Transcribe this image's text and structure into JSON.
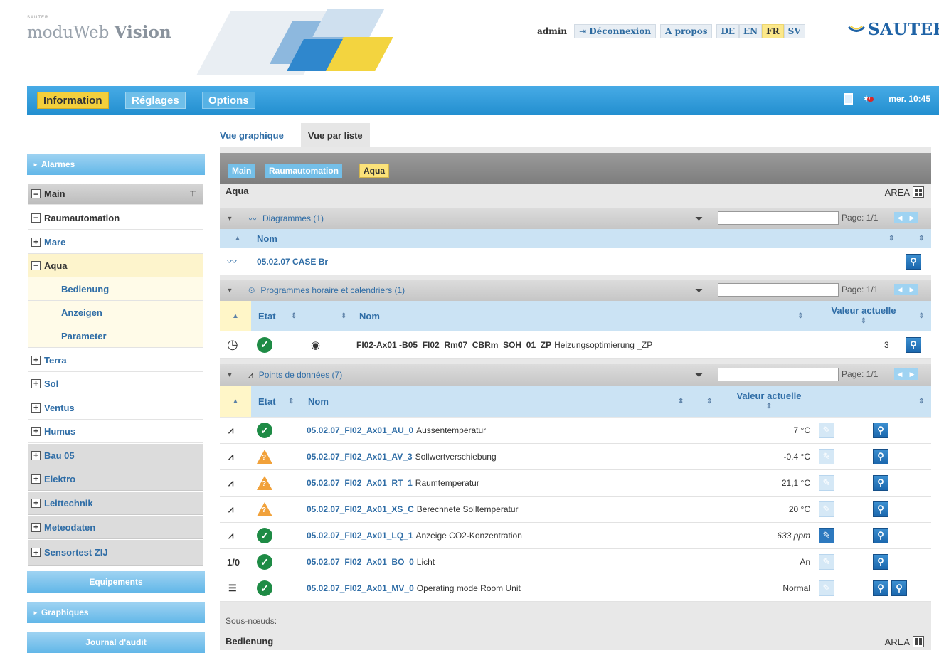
{
  "header": {
    "brand_small": "SAUTER",
    "brand_prefix": "moduWeb ",
    "brand_bold": "Vision",
    "user": "admin",
    "logout_label": "Déconnexion",
    "about_label": "A propos",
    "languages": [
      "DE",
      "EN",
      "FR",
      "SV"
    ],
    "active_language": "FR",
    "logo_text": "SAUTER"
  },
  "navbar": {
    "tabs": [
      "Information",
      "Réglages",
      "Options"
    ],
    "active_tab": "Information",
    "clock": "mer. 10:45"
  },
  "sidebar": {
    "headers": [
      "Alarmes",
      "Equipements",
      "Graphiques",
      "Journal d'audit"
    ],
    "tree": [
      {
        "label": "Main",
        "toggle": "−",
        "level": 0
      },
      {
        "label": "Raumautomation",
        "toggle": "−",
        "level": 0
      },
      {
        "label": "Mare",
        "toggle": "+",
        "level": 1
      },
      {
        "label": "Aqua",
        "toggle": "−",
        "level": 1,
        "active": true
      },
      {
        "label": "Bedienung",
        "level": 2
      },
      {
        "label": "Anzeigen",
        "level": 2
      },
      {
        "label": "Parameter",
        "level": 2
      },
      {
        "label": "Terra",
        "toggle": "+",
        "level": 1
      },
      {
        "label": "Sol",
        "toggle": "+",
        "level": 1
      },
      {
        "label": "Ventus",
        "toggle": "+",
        "level": 1
      },
      {
        "label": "Humus",
        "toggle": "+",
        "level": 1
      },
      {
        "label": "Bau 05",
        "toggle": "+",
        "level": 0
      },
      {
        "label": "Elektro",
        "toggle": "+",
        "level": 0
      },
      {
        "label": "Leittechnik",
        "toggle": "+",
        "level": 0
      },
      {
        "label": "Meteodaten",
        "toggle": "+",
        "level": 0
      },
      {
        "label": "Sensortest ZIJ",
        "toggle": "+",
        "level": 0
      }
    ]
  },
  "view_tabs": [
    "Vue graphique",
    "Vue par liste"
  ],
  "active_view_tab": "Vue par liste",
  "breadcrumb": [
    "Main",
    "Raumautomation",
    "Aqua"
  ],
  "node_title": "Aqua",
  "area_label": "AREA",
  "page_label": "Page: 1/1",
  "diagrams": {
    "title": "Diagrammes (1)",
    "col_name": "Nom",
    "rows": [
      {
        "name": "05.02.07 CASE Br"
      }
    ]
  },
  "schedules": {
    "title": "Programmes horaire et calendriers (1)",
    "col_state": "Etat",
    "col_name": "Nom",
    "col_value": "Valeur actuelle",
    "rows": [
      {
        "id": "FI02-Ax01 -B05_FI02_Rm07_CBRm_SOH_01_ZP",
        "desc": "Heizungsoptimierung _ZP",
        "value": "3",
        "state": "ok"
      }
    ]
  },
  "datapoints": {
    "title": "Points de données (7)",
    "col_state": "Etat",
    "col_name": "Nom",
    "col_value": "Valeur actuelle",
    "rows": [
      {
        "id": "05.02.07_FI02_Ax01_AU_0",
        "desc": "Aussentemperatur",
        "value": "7 °C",
        "state": "ok",
        "type_icon": "analog-input-icon"
      },
      {
        "id": "05.02.07_FI02_Ax01_AV_3",
        "desc": "Sollwertverschiebung",
        "value": "-0.4 °C",
        "state": "warn",
        "type_icon": "analog-value-icon"
      },
      {
        "id": "05.02.07_FI02_Ax01_RT_1",
        "desc": "Raumtemperatur",
        "value": "21,1 °C",
        "state": "warn",
        "type_icon": "analog-input-icon"
      },
      {
        "id": "05.02.07_FI02_Ax01_XS_C",
        "desc": "Berechnete Solltemperatur",
        "value": "20 °C",
        "state": "warn",
        "type_icon": "analog-value-icon"
      },
      {
        "id": "05.02.07_FI02_Ax01_LQ_1",
        "desc": "Anzeige CO2-Konzentration",
        "value": "633 ppm",
        "state": "ok",
        "type_icon": "analog-output-icon"
      },
      {
        "id": "05.02.07_FI02_Ax01_BO_0",
        "desc": "Licht",
        "value": "An",
        "state": "ok",
        "type_icon": "binary-output-icon",
        "type_text": "1/0"
      },
      {
        "id": "05.02.07_FI02_Ax01_MV_0",
        "desc": "Operating mode Room Unit",
        "value": "Normal",
        "state": "ok",
        "type_icon": "multistate-value-icon"
      }
    ]
  },
  "subnodes": {
    "label": "Sous-nœuds:",
    "first": "Bedienung"
  },
  "colors": {
    "nav_blue": "#238fd0",
    "active_yellow": "#f3cf3b",
    "ok_green": "#1e8b45",
    "warn_orange": "#f1a13a",
    "link_blue": "#2f6da6"
  }
}
